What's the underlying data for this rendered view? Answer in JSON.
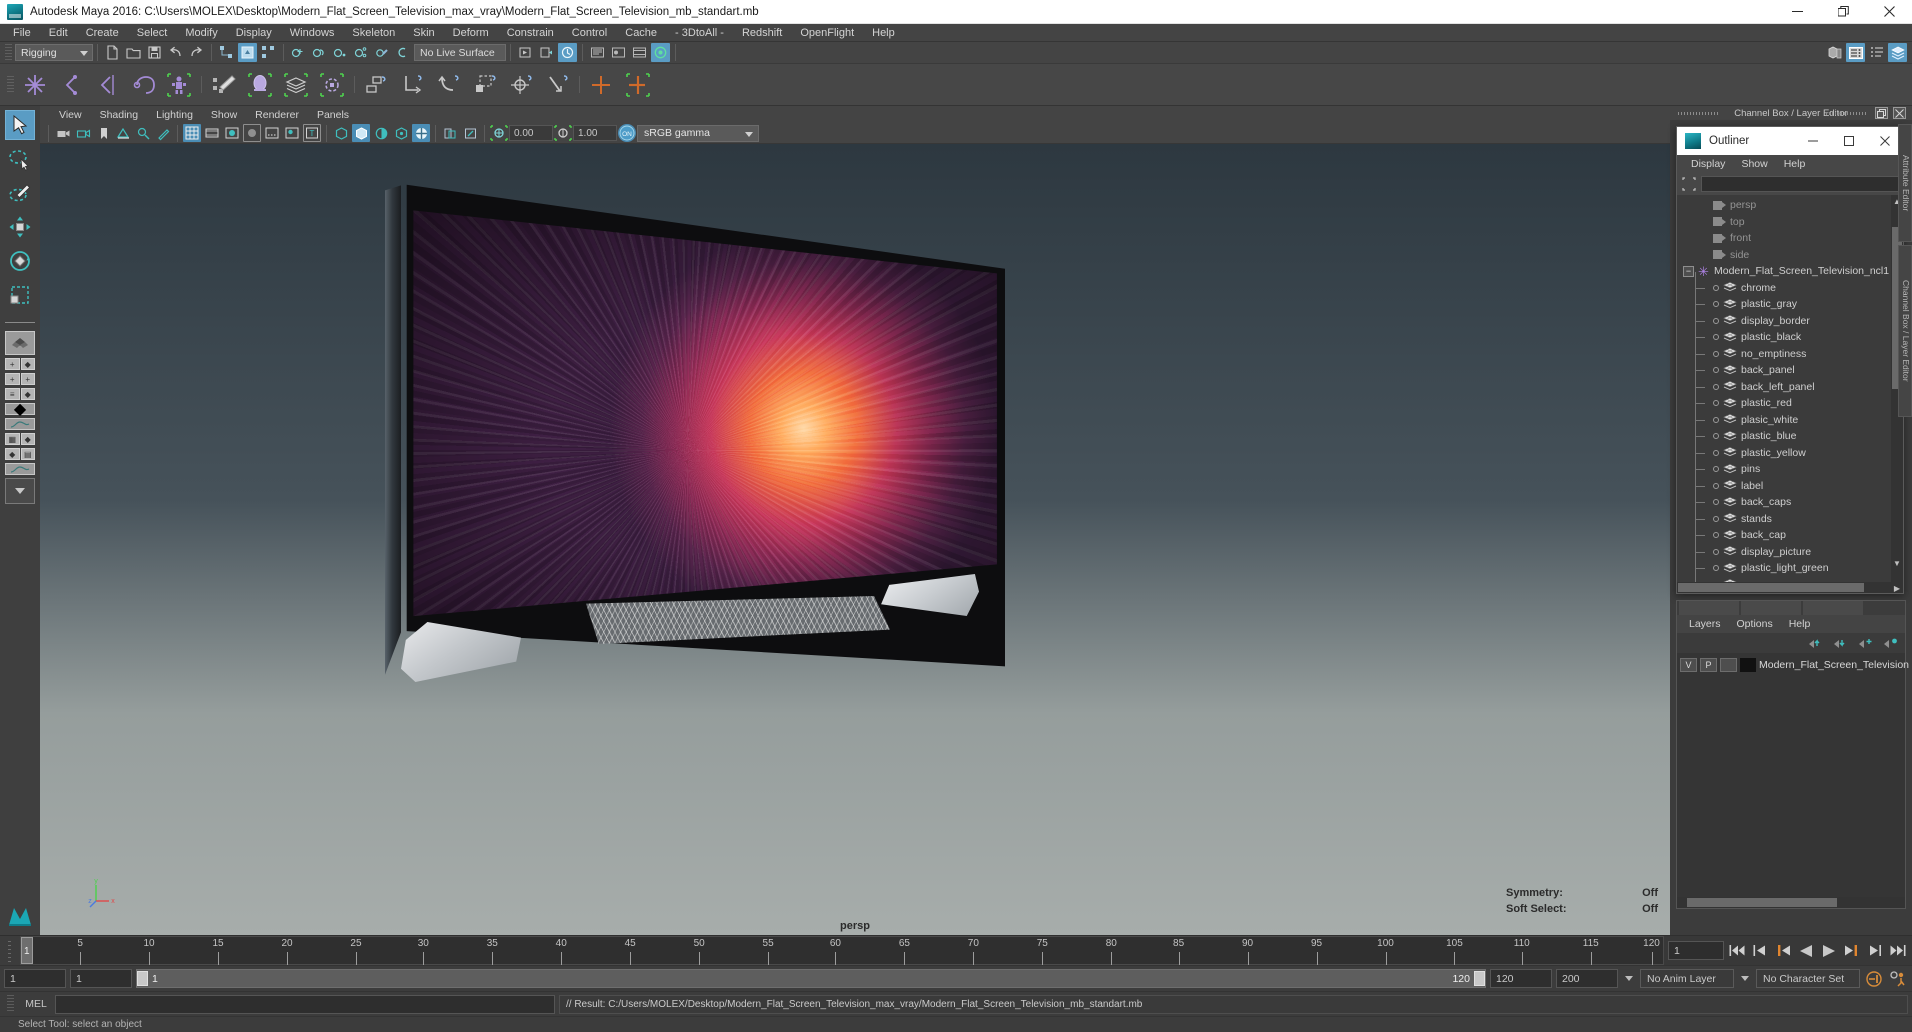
{
  "window": {
    "title": "Autodesk Maya 2016: C:\\Users\\MOLEX\\Desktop\\Modern_Flat_Screen_Television_max_vray\\Modern_Flat_Screen_Television_mb_standart.mb",
    "minimize": "—",
    "maximize": "❐",
    "close": "✕"
  },
  "menubar": {
    "items": [
      {
        "label": "File"
      },
      {
        "label": "Edit"
      },
      {
        "label": "Create"
      },
      {
        "label": "Select"
      },
      {
        "label": "Modify"
      },
      {
        "label": "Display"
      },
      {
        "label": "Windows"
      },
      {
        "label": "Skeleton"
      },
      {
        "label": "Skin"
      },
      {
        "label": "Deform"
      },
      {
        "label": "Constrain"
      },
      {
        "label": "Control"
      },
      {
        "label": "Cache"
      },
      {
        "label": "- 3DtoAll -"
      },
      {
        "label": "Redshift"
      },
      {
        "label": "OpenFlight"
      },
      {
        "label": "Help"
      }
    ]
  },
  "statusline": {
    "mode": "Rigging",
    "live_surface": "No Live Surface"
  },
  "viewport_panel": {
    "menus": [
      {
        "label": "View"
      },
      {
        "label": "Shading"
      },
      {
        "label": "Lighting"
      },
      {
        "label": "Show"
      },
      {
        "label": "Renderer"
      },
      {
        "label": "Panels"
      }
    ],
    "exposure": "0.00",
    "gamma": "1.00",
    "color_profile": "sRGB gamma",
    "camera_label": "persp",
    "hud": {
      "symmetry_label": "Symmetry:",
      "symmetry_value": "Off",
      "soft_select_label": "Soft Select:",
      "soft_select_value": "Off"
    },
    "axis": {
      "x": "x",
      "y": "y",
      "z": "z"
    }
  },
  "right_dock": {
    "header_title": "Channel Box / Layer Editor",
    "side_tabs": [
      "Attribute Editor",
      "Channel Box / Layer Editor"
    ]
  },
  "outliner": {
    "title": "Outliner",
    "minimize": "—",
    "maximize": "□",
    "close": "✕",
    "menus": [
      {
        "label": "Display"
      },
      {
        "label": "Show"
      },
      {
        "label": "Help"
      }
    ],
    "search_value": "",
    "cameras": [
      {
        "label": "persp"
      },
      {
        "label": "top"
      },
      {
        "label": "front"
      },
      {
        "label": "side"
      }
    ],
    "root": {
      "label": "Modern_Flat_Screen_Television_ncl1",
      "expander": "−"
    },
    "children": [
      {
        "label": "chrome"
      },
      {
        "label": "plastic_gray"
      },
      {
        "label": "display_border"
      },
      {
        "label": "plastic_black"
      },
      {
        "label": "no_emptiness"
      },
      {
        "label": "back_panel"
      },
      {
        "label": "back_left_panel"
      },
      {
        "label": "plastic_red"
      },
      {
        "label": "plasic_white"
      },
      {
        "label": "plastic_blue"
      },
      {
        "label": "plastic_yellow"
      },
      {
        "label": "pins"
      },
      {
        "label": "label"
      },
      {
        "label": "back_caps"
      },
      {
        "label": "stands"
      },
      {
        "label": "back_cap"
      },
      {
        "label": "display_picture"
      },
      {
        "label": "plastic_light_green"
      },
      {
        "label": "screws"
      }
    ]
  },
  "layer_editor": {
    "menus": [
      {
        "label": "Layers"
      },
      {
        "label": "Options"
      },
      {
        "label": "Help"
      }
    ],
    "columns": {
      "visibility": "V",
      "playback": "P"
    },
    "rows": [
      {
        "v": "V",
        "p": "P",
        "state": "",
        "color": "#111111",
        "name": "Modern_Flat_Screen_Television"
      }
    ]
  },
  "timeline": {
    "ticks": [
      {
        "value": "5",
        "pct": 3.6
      },
      {
        "value": "10",
        "pct": 7.8
      },
      {
        "value": "15",
        "pct": 12.0
      },
      {
        "value": "20",
        "pct": 16.2
      },
      {
        "value": "25",
        "pct": 20.4
      },
      {
        "value": "30",
        "pct": 24.5
      },
      {
        "value": "35",
        "pct": 28.7
      },
      {
        "value": "40",
        "pct": 32.9
      },
      {
        "value": "45",
        "pct": 37.1
      },
      {
        "value": "50",
        "pct": 41.3
      },
      {
        "value": "55",
        "pct": 45.5
      },
      {
        "value": "60",
        "pct": 49.6
      },
      {
        "value": "65",
        "pct": 53.8
      },
      {
        "value": "70",
        "pct": 58.0
      },
      {
        "value": "75",
        "pct": 62.2
      },
      {
        "value": "80",
        "pct": 66.4
      },
      {
        "value": "85",
        "pct": 70.5
      },
      {
        "value": "90",
        "pct": 74.7
      },
      {
        "value": "95",
        "pct": 78.9
      },
      {
        "value": "100",
        "pct": 83.1
      },
      {
        "value": "105",
        "pct": 87.3
      },
      {
        "value": "110",
        "pct": 91.4
      },
      {
        "value": "115",
        "pct": 95.6
      },
      {
        "value": "120",
        "pct": 99.3
      }
    ],
    "current_frame_marker": "1",
    "current_frame_field": "1"
  },
  "range": {
    "start": "1",
    "start2": "1",
    "bar_min": "1",
    "bar_max": "120",
    "end": "120",
    "end2": "200",
    "anim_layer": "No Anim Layer",
    "character_set": "No Character Set"
  },
  "command_line": {
    "language": "MEL",
    "input_value": "",
    "result": "// Result: C:/Users/MOLEX/Desktop/Modern_Flat_Screen_Television_max_vray/Modern_Flat_Screen_Television_mb_standart.mb"
  },
  "status_bar": {
    "message": "Select Tool: select an object"
  },
  "toolbox": {
    "tools": [
      {
        "name": "select-tool",
        "selected": true
      },
      {
        "name": "lasso-select-tool",
        "selected": false
      },
      {
        "name": "paint-select-tool",
        "selected": false
      },
      {
        "name": "move-tool",
        "selected": false
      },
      {
        "name": "rotate-tool",
        "selected": false
      },
      {
        "name": "scale-tool",
        "selected": false
      }
    ]
  },
  "colors": {
    "accent_blue": "#5a9cc4",
    "panel_bg": "#3c3c3c",
    "toolbar_bg": "#444444",
    "purple_icon": "#b084e8",
    "teal_icon": "#2bb5c4",
    "orange": "#e08a3c"
  }
}
